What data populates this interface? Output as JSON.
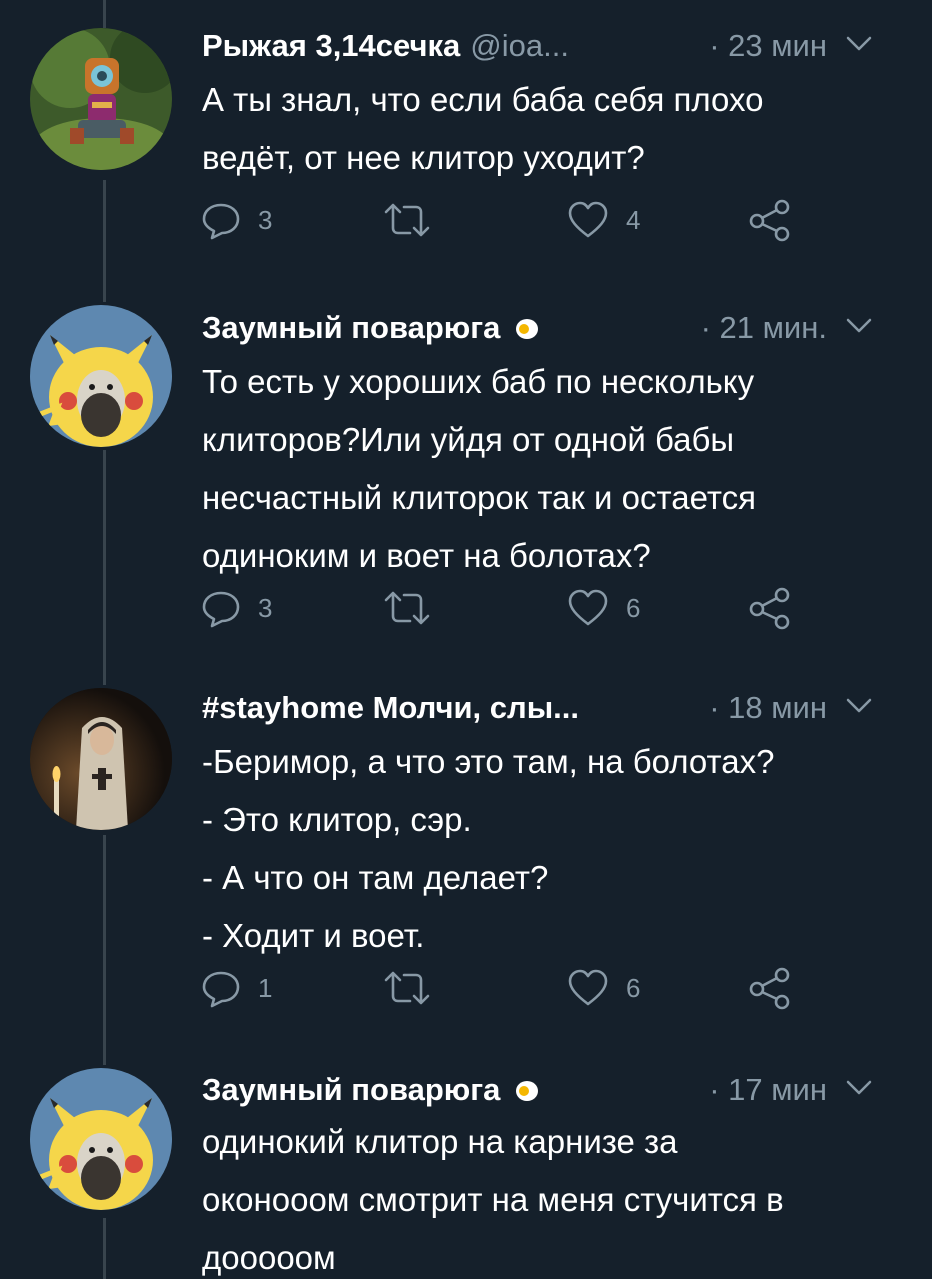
{
  "tweets": [
    {
      "name": "Рыжая 3,14сечка",
      "handle": "@ioa...",
      "time": "· 23 мин",
      "lines": [
        "А ты знал, что если баба себя плохо",
        "ведёт, от нее клитор уходит?"
      ],
      "replies": "3",
      "retweets": "",
      "likes": "4"
    },
    {
      "name": "Заумный поварюга",
      "badge": "egg-icon",
      "time": "· 21 мин.",
      "lines": [
        "То есть у хороших баб по нескольку",
        "клиторов?Или уйдя от одной бабы",
        "несчастный клиторок так и остается",
        "одиноким и воет на болотах?"
      ],
      "replies": "3",
      "retweets": "",
      "likes": "6"
    },
    {
      "name": "#stayhome Молчи, слы...",
      "time": "· 18 мин",
      "lines": [
        "-Беримор, а что это там, на болотах?",
        "- Это клитор, сэр.",
        "- А что он там делает?",
        "- Ходит и воет."
      ],
      "replies": "1",
      "retweets": "",
      "likes": "6"
    },
    {
      "name": "Заумный поварюга",
      "badge": "egg-icon",
      "time": "· 17 мин",
      "lines": [
        "одинокий клитор на карнизе за",
        "оконооом смотрит на меня стучится в",
        "дооооом"
      ]
    }
  ],
  "colors": {
    "background": "#15202b",
    "text": "#ffffff",
    "muted": "#8899a6",
    "thread": "#38444d"
  }
}
